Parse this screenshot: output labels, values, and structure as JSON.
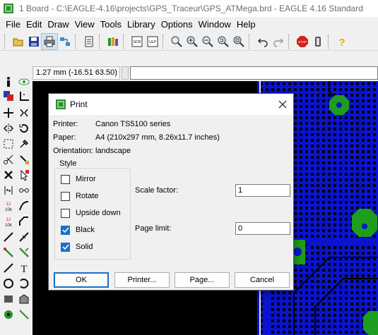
{
  "window": {
    "title": "1 Board - C:\\EAGLE-4.16\\projects\\GPS_Traceur\\GPS_ATMega.brd - EAGLE 4.16 Standard"
  },
  "menu": [
    "File",
    "Edit",
    "Draw",
    "View",
    "Tools",
    "Library",
    "Options",
    "Window",
    "Help"
  ],
  "toolbar": {
    "icons": [
      "open-icon",
      "save-icon",
      "print-icon",
      "cam-icon",
      "script-icon",
      "library-icon",
      "scr-icon",
      "ulp-icon",
      "zoom-fit-icon",
      "zoom-in-icon",
      "zoom-out-icon",
      "redraw-icon",
      "zoom-select-icon",
      "undo-icon",
      "redo-icon",
      "stop-icon",
      "go-icon",
      "help-icon"
    ],
    "labels": {
      "scr": "SCR",
      "ulp": "ULP",
      "stop": "STOP"
    }
  },
  "coord": {
    "value": "1.27 mm (-16.51 63.50)"
  },
  "palette": {
    "icons": [
      "info-icon",
      "eye-icon",
      "layers-icon",
      "mark-icon",
      "move-icon",
      "copy-icon",
      "mirror-icon",
      "rotate-icon",
      "group-icon",
      "change-icon",
      "cut-icon",
      "paste-icon",
      "delete-icon",
      "add-icon",
      "pinswap-icon",
      "replace-icon",
      "name-icon",
      "value-icon",
      "smash-icon",
      "miter-icon",
      "split-icon",
      "optimize-icon",
      "route-icon",
      "ripup-icon",
      "wire-icon",
      "text-icon",
      "circle-icon",
      "arc-icon",
      "rect-icon",
      "polygon-icon",
      "via-icon",
      "signal-icon"
    ],
    "labels": {
      "name": "12\n10k",
      "value": "12\n10k"
    }
  },
  "dialog": {
    "title": "Print",
    "info": {
      "printer_label": "Printer:",
      "printer_value": "Canon TS5100 series",
      "paper_label": "Paper:",
      "paper_value": "A4 (210x297 mm, 8.26x11.7 inches)",
      "orientation_label": "Orientation:",
      "orientation_value": "landscape"
    },
    "style_group": "Style",
    "options": [
      {
        "label": "Mirror",
        "checked": false
      },
      {
        "label": "Rotate",
        "checked": false
      },
      {
        "label": "Upside down",
        "checked": false
      },
      {
        "label": "Black",
        "checked": true
      },
      {
        "label": "Solid",
        "checked": true
      }
    ],
    "scale_factor_label": "Scale factor:",
    "scale_factor_value": "1",
    "page_limit_label": "Page limit:",
    "page_limit_value": "0",
    "buttons": {
      "ok": "OK",
      "printer": "Printer...",
      "page": "Page...",
      "cancel": "Cancel"
    }
  },
  "colors": {
    "accent": "#1a6fc8",
    "board_blue": "#0a14d0",
    "pad_green": "#1e9e1e",
    "canvas_bg": "#000000"
  }
}
